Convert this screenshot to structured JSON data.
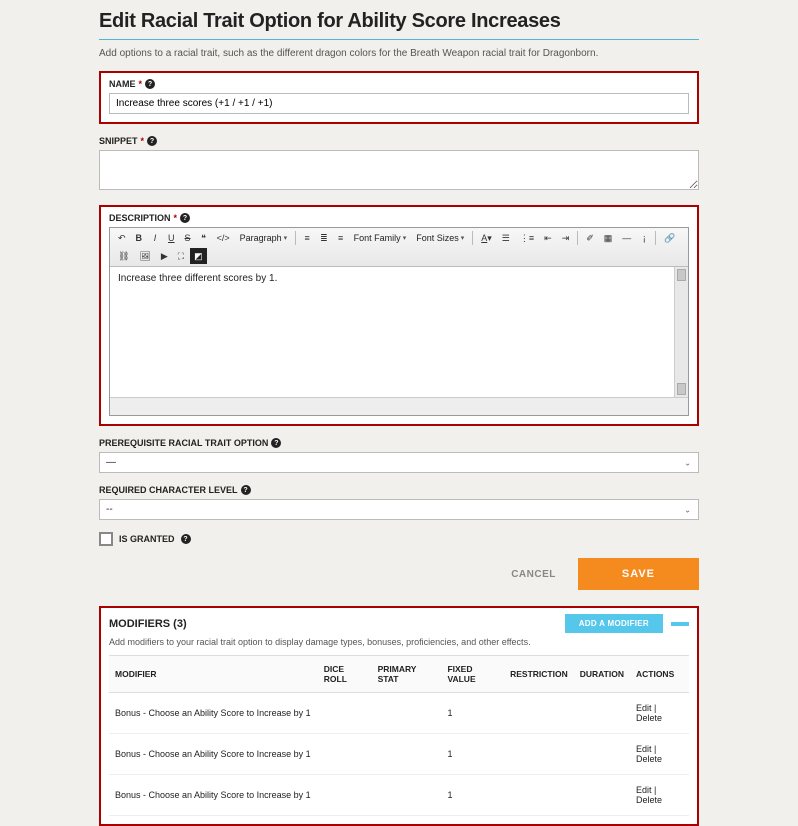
{
  "page": {
    "title": "Edit Racial Trait Option for Ability Score Increases",
    "subtitle": "Add options to a racial trait, such as the different dragon colors for the Breath Weapon racial trait for Dragonborn."
  },
  "fields": {
    "name": {
      "label": "NAME",
      "value": "Increase three scores (+1 / +1 / +1)"
    },
    "snippet": {
      "label": "SNIPPET",
      "value": ""
    },
    "description": {
      "label": "DESCRIPTION",
      "value": "Increase three different scores by 1."
    },
    "prereq": {
      "label": "PREREQUISITE RACIAL TRAIT OPTION",
      "value": "—"
    },
    "level": {
      "label": "REQUIRED CHARACTER LEVEL",
      "value": "--"
    },
    "granted": {
      "label": "IS GRANTED"
    }
  },
  "rte": {
    "format_dd": "Paragraph",
    "font_family_dd": "Font Family",
    "font_size_dd": "Font Sizes"
  },
  "buttons": {
    "cancel": "CANCEL",
    "save": "SAVE"
  },
  "modifiers": {
    "title": "MODIFIERS (3)",
    "add_label": "ADD A MODIFIER",
    "subtitle": "Add modifiers to your racial trait option to display damage types, bonuses, proficiencies, and other effects.",
    "columns": {
      "modifier": "MODIFIER",
      "dice": "DICE ROLL",
      "primary": "PRIMARY STAT",
      "fixed": "FIXED VALUE",
      "restriction": "RESTRICTION",
      "duration": "DURATION",
      "actions": "ACTIONS"
    },
    "rows": [
      {
        "modifier": "Bonus - Choose an Ability Score to Increase by 1",
        "dice": "",
        "primary": "",
        "fixed": "1",
        "restriction": "",
        "duration": ""
      },
      {
        "modifier": "Bonus - Choose an Ability Score to Increase by 1",
        "dice": "",
        "primary": "",
        "fixed": "1",
        "restriction": "",
        "duration": ""
      },
      {
        "modifier": "Bonus - Choose an Ability Score to Increase by 1",
        "dice": "",
        "primary": "",
        "fixed": "1",
        "restriction": "",
        "duration": ""
      }
    ],
    "action_edit": "Edit",
    "action_sep": " | ",
    "action_delete": "Delete"
  }
}
